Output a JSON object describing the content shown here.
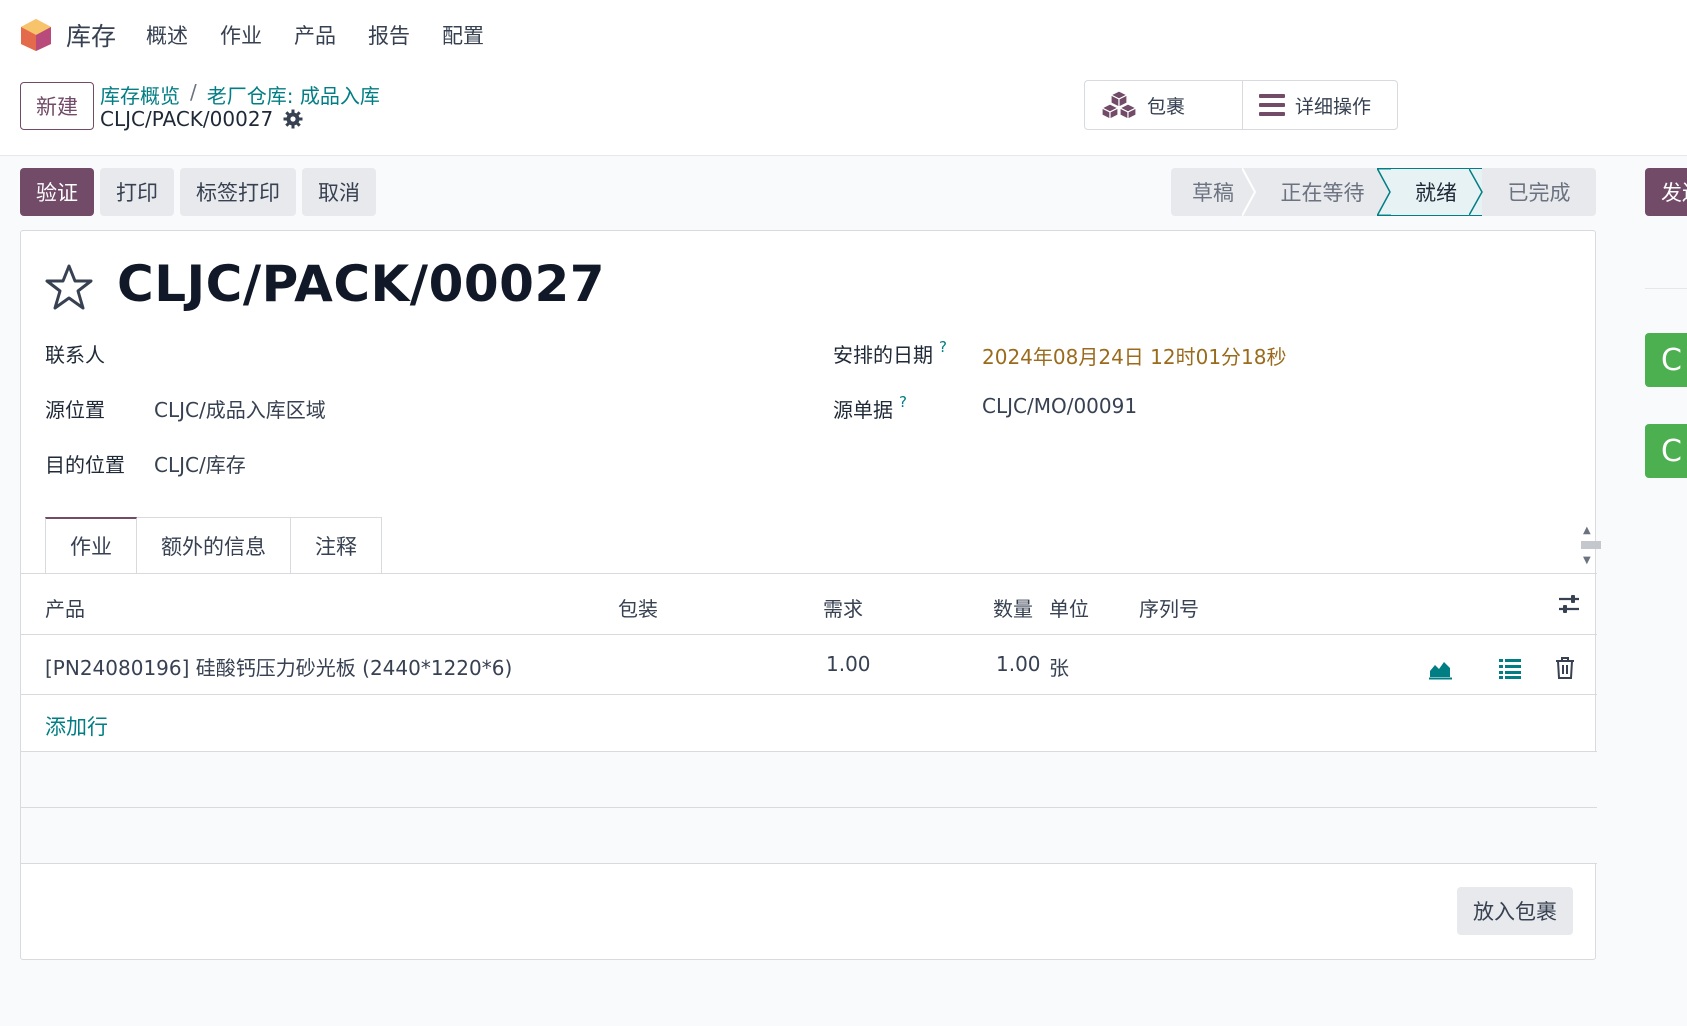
{
  "navbar": {
    "app_name": "库存",
    "menu": [
      "概述",
      "作业",
      "产品",
      "报告",
      "配置"
    ]
  },
  "control_panel": {
    "new_label": "新建",
    "breadcrumb": [
      "库存概览",
      "老厂仓库: 成品入库"
    ],
    "breadcrumb_sep": "/",
    "record_name": "CLJC/PACK/00027",
    "smart_buttons": {
      "package": "包裹",
      "detailed_ops": "详细操作"
    }
  },
  "actions": {
    "validate": "验证",
    "print": "打印",
    "label_print": "标签打印",
    "cancel": "取消",
    "side_button": "发送"
  },
  "statusbar": {
    "stages": [
      "草稿",
      "正在等待",
      "就绪",
      "已完成"
    ],
    "current": "就绪"
  },
  "form": {
    "title": "CLJC/PACK/00027",
    "fields": {
      "contact_label": "联系人",
      "contact_value": "",
      "source_location_label": "源位置",
      "source_location_value": "CLJC/成品入库区域",
      "dest_location_label": "目的位置",
      "dest_location_value": "CLJC/库存",
      "scheduled_date_label": "安排的日期",
      "scheduled_date_value": "2024年08月24日 12时01分18秒",
      "source_document_label": "源单据",
      "source_document_value": "CLJC/MO/00091",
      "help_mark": "?"
    },
    "tabs": [
      "作业",
      "额外的信息",
      "注释"
    ],
    "table": {
      "headers": {
        "product": "产品",
        "packaging": "包装",
        "demand": "需求",
        "quantity": "数量",
        "uom": "单位",
        "serial": "序列号"
      },
      "rows": [
        {
          "product": "[PN24080196] 硅酸钙压力砂光板 (2440*1220*6)",
          "packaging": "",
          "demand": "1.00",
          "quantity": "1.00",
          "uom": "张",
          "serial": ""
        }
      ],
      "add_line": "添加行"
    },
    "put_in_pack": "放入包裹"
  },
  "side_panel": {
    "green_badges": [
      "C",
      "C"
    ]
  },
  "colors": {
    "primary": "#714b67",
    "link": "#017e84",
    "date": "#9a6b1c",
    "success": "#4caf50"
  },
  "icons": [
    "app-logo-icon",
    "gear-icon",
    "boxes-icon",
    "bars-icon",
    "star-icon",
    "settings-sliders-icon",
    "area-chart-icon",
    "list-icon",
    "trash-icon"
  ]
}
